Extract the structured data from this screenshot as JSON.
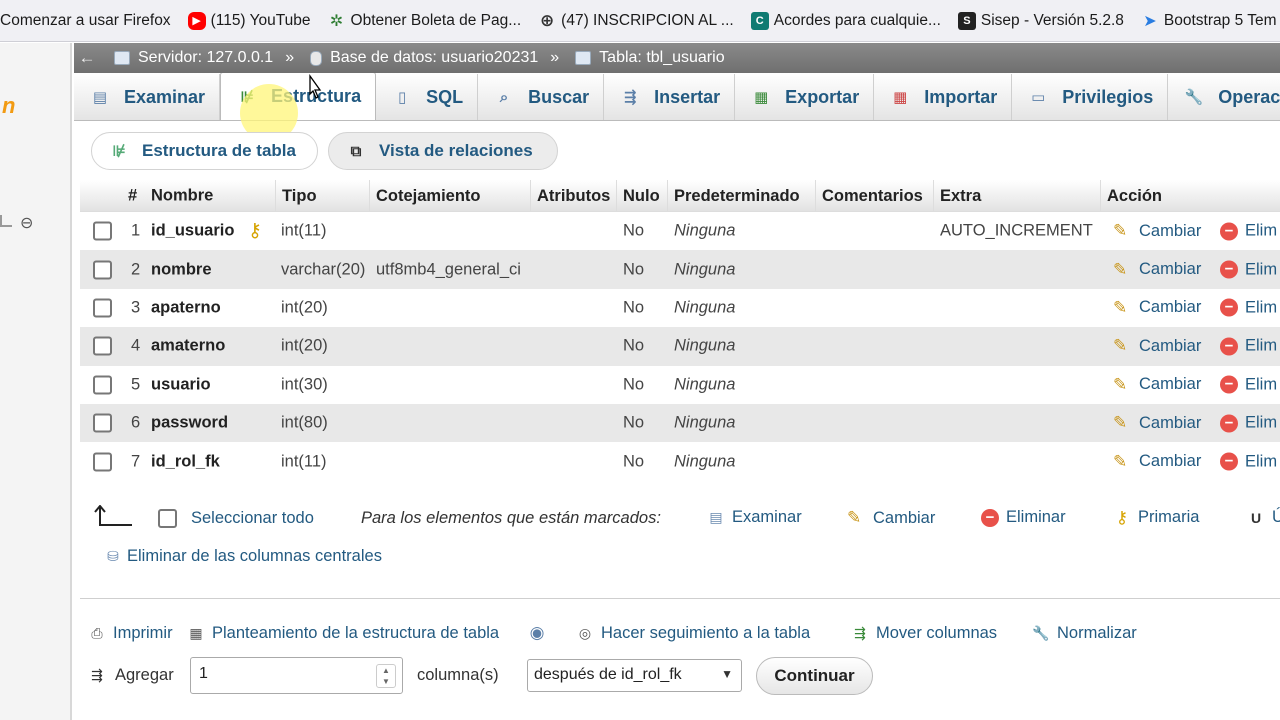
{
  "bookmarks": [
    {
      "label": "Comenzar a usar Firefox",
      "icon": "firefox-icon",
      "color": "#ff7139"
    },
    {
      "label": "(115) YouTube",
      "icon": "youtube-icon",
      "color": "#ff0000"
    },
    {
      "label": "Obtener Boleta de Pag...",
      "icon": "gear-icon",
      "color": "#2e7d32"
    },
    {
      "label": "(47) INSCRIPCION AL ...",
      "icon": "globe-icon",
      "color": "#333333"
    },
    {
      "label": "Acordes para cualquie...",
      "icon": "music-icon",
      "color": "#0f7b72"
    },
    {
      "label": "Sisep - Versión 5.2.8",
      "icon": "s-icon",
      "color": "#222222"
    },
    {
      "label": "Bootstrap 5 Tem",
      "icon": "bird-icon",
      "color": "#2a7de1"
    }
  ],
  "breadcrumb": {
    "server": "Servidor: 127.0.0.1",
    "database": "Base de datos: usuario20231",
    "table": "Tabla: tbl_usuario",
    "separator": "»"
  },
  "tabs": [
    {
      "label": "Examinar",
      "icon": "browse-icon"
    },
    {
      "label": "Estructura",
      "icon": "structure-icon",
      "active": true
    },
    {
      "label": "SQL",
      "icon": "sql-icon"
    },
    {
      "label": "Buscar",
      "icon": "search-icon"
    },
    {
      "label": "Insertar",
      "icon": "insert-icon"
    },
    {
      "label": "Exportar",
      "icon": "export-icon"
    },
    {
      "label": "Importar",
      "icon": "import-icon"
    },
    {
      "label": "Privilegios",
      "icon": "privileges-icon"
    },
    {
      "label": "Operacio",
      "icon": "wrench-icon"
    }
  ],
  "subnav": {
    "structure": "Estructura de tabla",
    "relations": "Vista de relaciones"
  },
  "columns": [
    "#",
    "Nombre",
    "Tipo",
    "Cotejamiento",
    "Atributos",
    "Nulo",
    "Predeterminado",
    "Comentarios",
    "Extra",
    "Acción"
  ],
  "rows": [
    {
      "num": "1",
      "name": "id_usuario",
      "type": "int(11)",
      "collation": "",
      "null": "No",
      "default": "Ninguna",
      "extra": "AUTO_INCREMENT",
      "primary": true
    },
    {
      "num": "2",
      "name": "nombre",
      "type": "varchar(20)",
      "collation": "utf8mb4_general_ci",
      "null": "No",
      "default": "Ninguna",
      "extra": ""
    },
    {
      "num": "3",
      "name": "apaterno",
      "type": "int(20)",
      "collation": "",
      "null": "No",
      "default": "Ninguna",
      "extra": ""
    },
    {
      "num": "4",
      "name": "amaterno",
      "type": "int(20)",
      "collation": "",
      "null": "No",
      "default": "Ninguna",
      "extra": ""
    },
    {
      "num": "5",
      "name": "usuario",
      "type": "int(30)",
      "collation": "",
      "null": "No",
      "default": "Ninguna",
      "extra": ""
    },
    {
      "num": "6",
      "name": "password",
      "type": "int(80)",
      "collation": "",
      "null": "No",
      "default": "Ninguna",
      "extra": ""
    },
    {
      "num": "7",
      "name": "id_rol_fk",
      "type": "int(11)",
      "collation": "",
      "null": "No",
      "default": "Ninguna",
      "extra": ""
    }
  ],
  "row_actions": {
    "change": "Cambiar",
    "delete": "Elim"
  },
  "bulk": {
    "select_all": "Seleccionar todo",
    "marked": "Para los elementos que están marcados:",
    "browse": "Examinar",
    "change": "Cambiar",
    "delete": "Eliminar",
    "primary": "Primaria",
    "unique": "Ú",
    "remove_central": "Eliminar de las columnas centrales"
  },
  "tools": {
    "print": "Imprimir",
    "propose": "Planteamiento de la estructura de tabla",
    "track": "Hacer seguimiento a la tabla",
    "move": "Mover columnas",
    "normalize": "Normalizar"
  },
  "add_columns": {
    "label": "Agregar",
    "value": "1",
    "unit": "columna(s)",
    "position": "después de id_rol_fk",
    "submit": "Continuar"
  },
  "colors": {
    "link": "#235a81",
    "accent": "#f29b13",
    "delete": "#e8514a"
  }
}
